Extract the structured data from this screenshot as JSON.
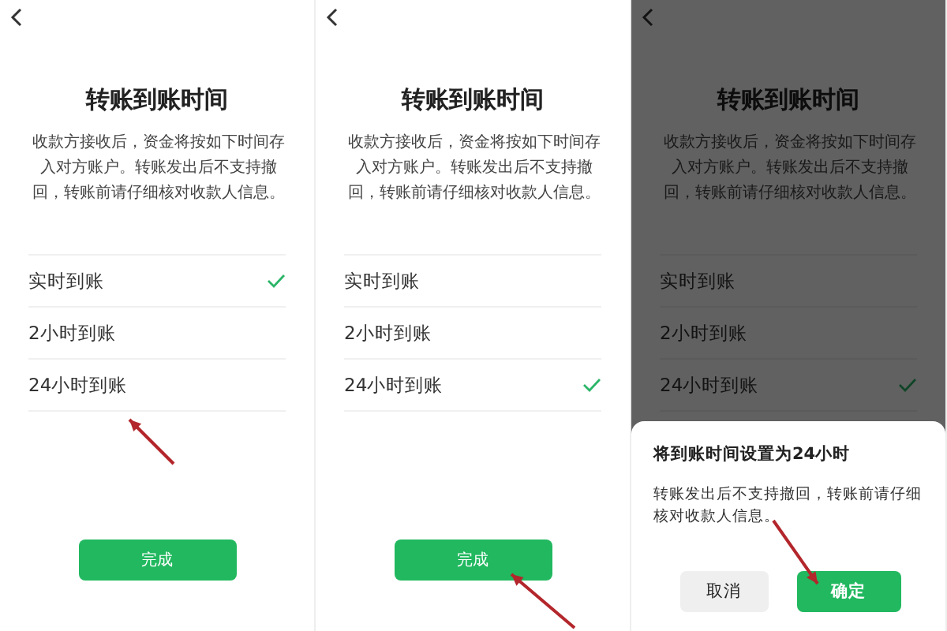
{
  "panels": [
    {
      "title": "转账到账时间",
      "description": "收款方接收后，资金将按如下时间存入对方账户。转账发出后不支持撤回，转账前请仔细核对收款人信息。",
      "options": [
        {
          "label": "实时到账",
          "selected": true
        },
        {
          "label": "2小时到账",
          "selected": false
        },
        {
          "label": "24小时到账",
          "selected": false
        }
      ],
      "done_button": "完成",
      "pointer": {
        "kind": "option"
      }
    },
    {
      "title": "转账到账时间",
      "description": "收款方接收后，资金将按如下时间存入对方账户。转账发出后不支持撤回，转账前请仔细核对收款人信息。",
      "options": [
        {
          "label": "实时到账",
          "selected": false
        },
        {
          "label": "2小时到账",
          "selected": false
        },
        {
          "label": "24小时到账",
          "selected": true
        }
      ],
      "done_button": "完成",
      "pointer": {
        "kind": "button"
      }
    },
    {
      "title": "转账到账时间",
      "description": "收款方接收后，资金将按如下时间存入对方账户。转账发出后不支持撤回，转账前请仔细核对收款人信息。",
      "options": [
        {
          "label": "实时到账",
          "selected": false
        },
        {
          "label": "2小时到账",
          "selected": false
        },
        {
          "label": "24小时到账",
          "selected": true
        }
      ],
      "pointer": {
        "kind": "confirm"
      },
      "dialog": {
        "title": "将到账时间设置为24小时",
        "message": "转账发出后不支持撤回，转账前请仔细核对收款人信息。",
        "cancel_button": "取消",
        "confirm_button": "确定"
      }
    }
  ]
}
